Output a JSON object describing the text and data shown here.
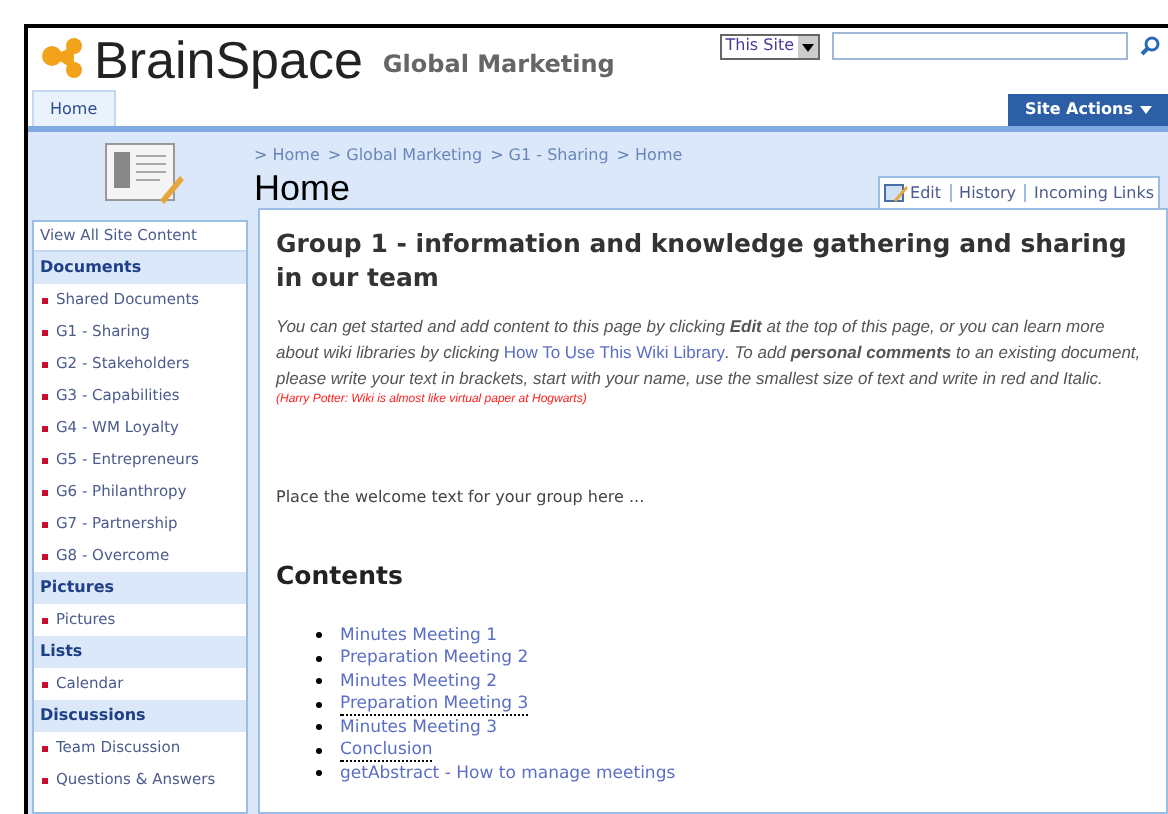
{
  "header": {
    "site_name": "BrainSpace",
    "subsite": "Global Marketing",
    "scope": "This Site"
  },
  "top_nav": {
    "tabs": [
      {
        "label": "Home",
        "selected": true
      }
    ],
    "site_actions": "Site Actions"
  },
  "breadcrumb": [
    {
      "label": "> Home"
    },
    {
      "label": "> Global Marketing"
    },
    {
      "label": "> G1 - Sharing"
    },
    {
      "label": "> Home"
    }
  ],
  "page_title": "Home",
  "page_toolbar": [
    "Edit",
    "History",
    "Incoming Links"
  ],
  "sidebar": {
    "view_all": "View All Site Content",
    "sections": [
      {
        "title": "Documents",
        "items": [
          "Shared Documents",
          "G1 - Sharing",
          "G2 - Stakeholders",
          "G3 - Capabilities",
          "G4 - WM Loyalty",
          "G5 - Entrepreneurs",
          "G6 - Philanthropy",
          "G7 - Partnership",
          "G8 - Overcome"
        ]
      },
      {
        "title": "Pictures",
        "items": [
          "Pictures"
        ]
      },
      {
        "title": "Lists",
        "items": [
          "Calendar"
        ]
      },
      {
        "title": "Discussions",
        "items": [
          "Team Discussion",
          "Questions & Answers"
        ]
      }
    ]
  },
  "content": {
    "heading": "Group 1 - information and knowledge gathering and sharing in our team",
    "intro": [
      {
        "kind": "text",
        "text": "You can get started and add content to this page by clicking **Edit** at the top of this page, or you can learn more about wiki libraries by clicking "
      },
      {
        "kind": "link",
        "text": "How To Use This Wiki Library"
      },
      {
        "kind": "text",
        "text": ". To add **personal comments** to an existing document, please write your text in brackets, start with your name, use the smallest size of text and write in red and Italic."
      }
    ],
    "note": "(Harry Potter: Wiki is almost like virtual paper at Hogwarts)",
    "welcome": "Place the welcome text for your group here ...",
    "contents_title": "Contents",
    "contents": [
      {
        "label": "Minutes Meeting 1",
        "dotted": false
      },
      {
        "label": "Preparation Meeting 2",
        "dotted": false
      },
      {
        "label": "Minutes Meeting 2",
        "dotted": false
      },
      {
        "label": "Preparation Meeting 3",
        "dotted": true
      },
      {
        "label": "Minutes Meeting 3",
        "dotted": false
      },
      {
        "label": "Conclusion",
        "dotted": true
      },
      {
        "label": "getAbstract - How to manage meetings",
        "dotted": false
      }
    ]
  }
}
